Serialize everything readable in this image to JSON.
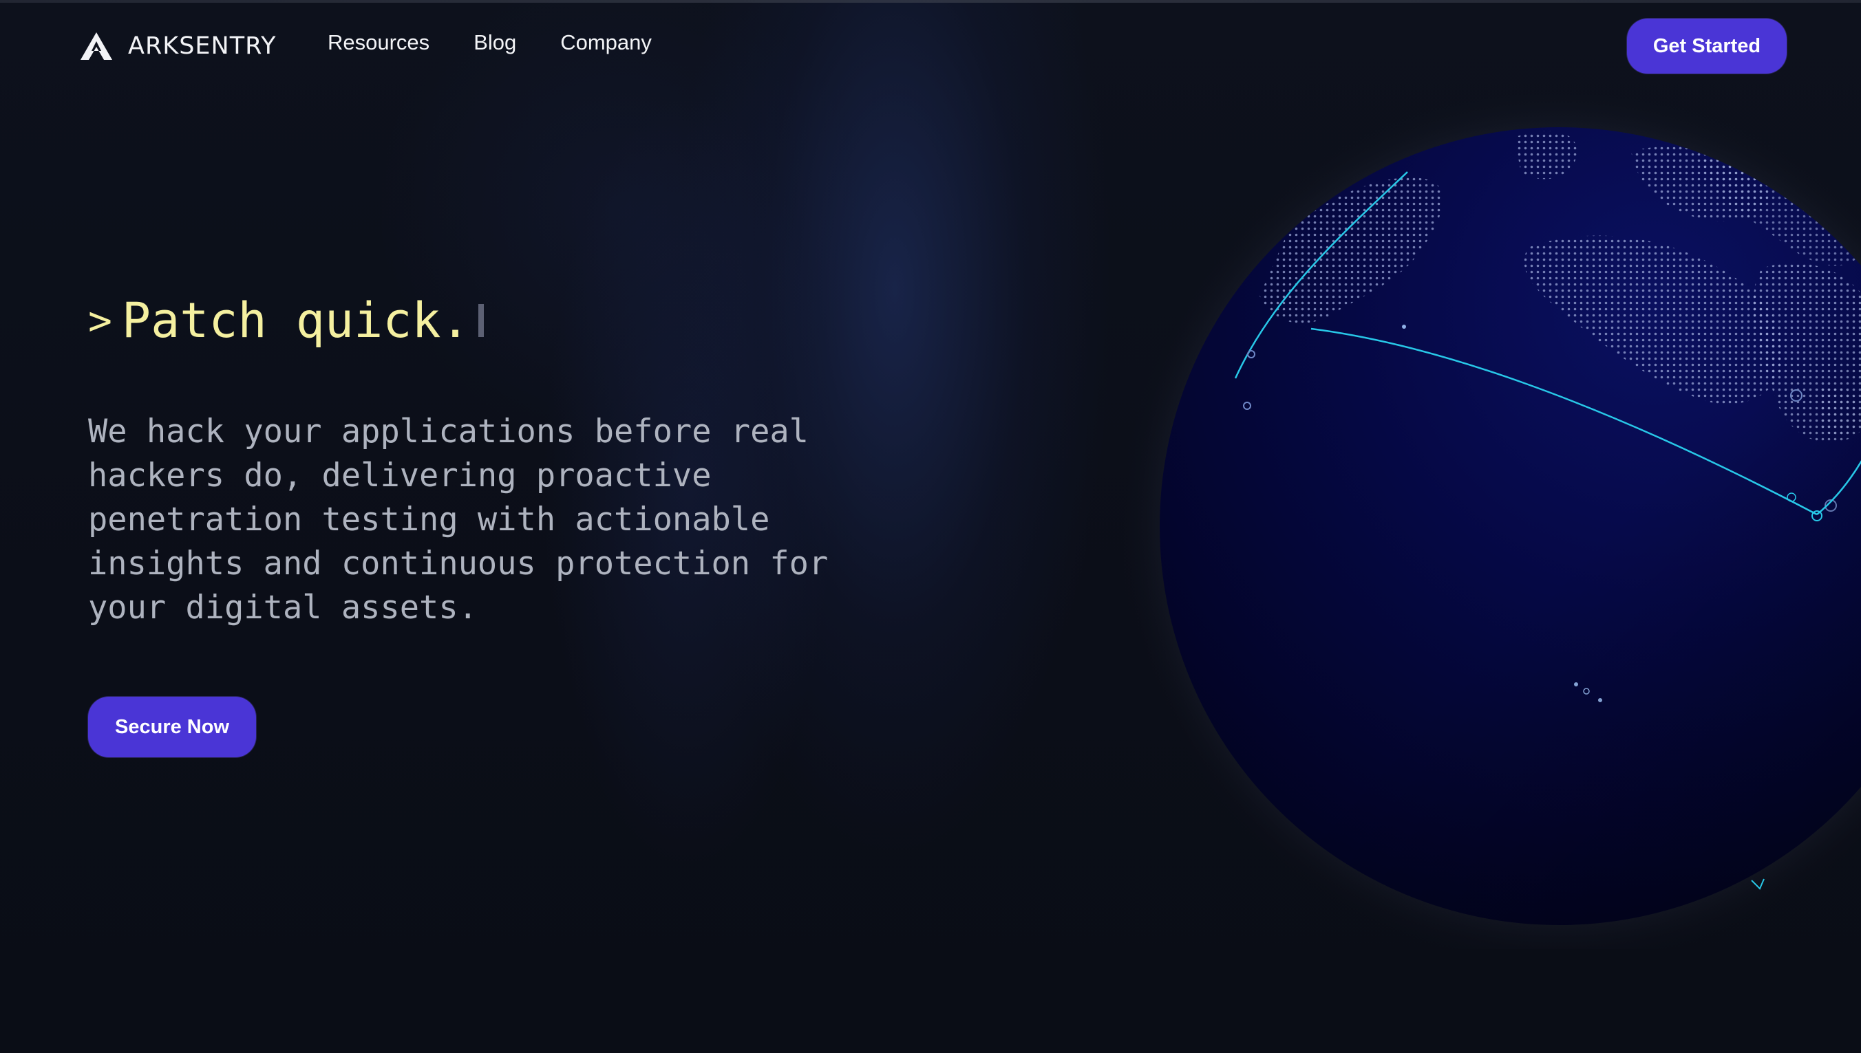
{
  "brand": {
    "name": "ARKSENTRY",
    "logo_icon": "arksentry-logo-icon"
  },
  "nav": {
    "links": [
      {
        "label": "Resources"
      },
      {
        "label": "Blog"
      },
      {
        "label": "Company"
      }
    ],
    "cta_label": "Get Started"
  },
  "hero": {
    "prompt_symbol": ">",
    "headline": "Patch quick.",
    "description": "We hack your applications before real hackers do, delivering proactive penetration testing with actionable insights and continuous protection for your digital assets.",
    "cta_label": "Secure Now"
  },
  "visual": {
    "globe_icon": "globe-icon"
  },
  "colors": {
    "background": "#0b0e18",
    "accent": "#4a35d6",
    "headline": "#f5f0a0",
    "body_text": "#aeb3bf",
    "globe_fill": "#04063a",
    "arc": "#28c8e8"
  }
}
